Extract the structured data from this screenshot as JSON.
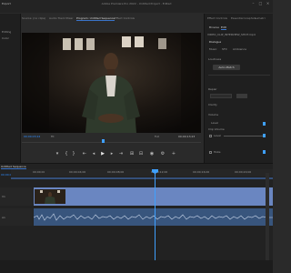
{
  "app": {
    "menu_left": "Export",
    "title": "Adobe Premiere Pro 2022 - Untitled Project - Edited"
  },
  "source_panel": {
    "tabs": [
      "Source: (no clips)",
      "Audio Track Mixer",
      "Effect Controls"
    ],
    "side_tab": "Editing",
    "side_tab2": "Color"
  },
  "program_panel": {
    "tab": "Program: Untitled Sequence",
    "timecode_current": "00;00;03;24",
    "fit_label": "Fit",
    "quality_label": "Full",
    "timecode_duration": "00;00;13;23"
  },
  "right_panel": {
    "tabs": [
      "Effect Controls",
      "Essential Graphics",
      "Lumetri"
    ],
    "header_tabs": [
      "Browse",
      "Edit"
    ],
    "clip_name": "VIDEO_CLIP_INTERVIEW_SHOT.mp4",
    "items": [
      "Dialogue",
      "Music",
      "SFX",
      "Ambience"
    ],
    "section_loudness": "Loudness",
    "auto_match_label": "Auto-Match",
    "section_repair": "Repair",
    "section_clarity": "Clarity",
    "section_volume": "Volume",
    "level_label": "Level",
    "clip_volume": "Clip Volume",
    "level_check": "Level",
    "mute_check": "Mute"
  },
  "timeline": {
    "tab": "Untitled Sequence",
    "timecode": "00;00;03;24",
    "ruler_labels": [
      "00;00;00",
      "00;00;04;00",
      "00;00;08;00",
      "00;00;12;00",
      "00;00;16;00",
      "00;00;20;00"
    ],
    "video_track": "V1",
    "audio_track": "A1"
  },
  "colors": {
    "accent": "#3a74c9",
    "timecode": "#2f8cff",
    "video_clip": "#6a86c1",
    "audio_clip": "#38557d",
    "background": "#2a2a2a"
  },
  "icons": [
    "play-icon",
    "step-back-icon",
    "step-forward-icon",
    "mark-in-icon",
    "mark-out-icon",
    "camera-icon",
    "settings-icon",
    "add-icon"
  ]
}
